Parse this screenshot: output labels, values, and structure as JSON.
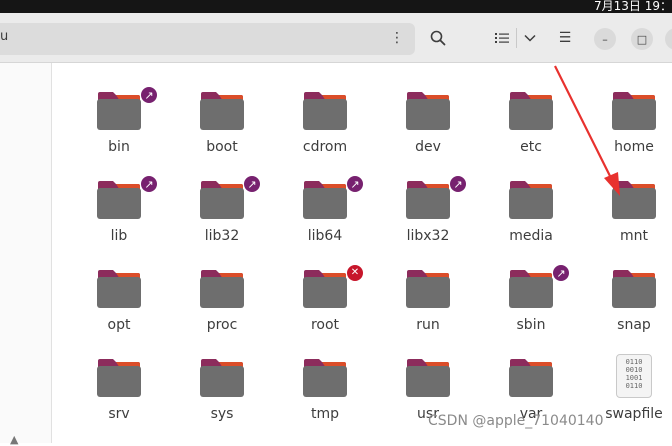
{
  "topbar": {
    "clock": "7月13日 19："
  },
  "pathbar": {
    "crumb": "u",
    "more_glyph": "⋮"
  },
  "headerbar": {
    "search_glyph": "",
    "view_dropdown_glyph": "",
    "menu_glyph": "☰"
  },
  "window_controls": {
    "minimize": "–",
    "maximize": "□",
    "close": "×"
  },
  "files": [
    {
      "name": "bin",
      "type": "folder",
      "emblem": "link"
    },
    {
      "name": "boot",
      "type": "folder",
      "emblem": ""
    },
    {
      "name": "cdrom",
      "type": "folder",
      "emblem": ""
    },
    {
      "name": "dev",
      "type": "folder",
      "emblem": ""
    },
    {
      "name": "etc",
      "type": "folder",
      "emblem": ""
    },
    {
      "name": "home",
      "type": "folder",
      "emblem": ""
    },
    {
      "name": "lib",
      "type": "folder",
      "emblem": "link"
    },
    {
      "name": "lib32",
      "type": "folder",
      "emblem": "link"
    },
    {
      "name": "lib64",
      "type": "folder",
      "emblem": "link"
    },
    {
      "name": "libx32",
      "type": "folder",
      "emblem": "link"
    },
    {
      "name": "media",
      "type": "folder",
      "emblem": ""
    },
    {
      "name": "mnt",
      "type": "folder",
      "emblem": ""
    },
    {
      "name": "opt",
      "type": "folder",
      "emblem": ""
    },
    {
      "name": "proc",
      "type": "folder",
      "emblem": ""
    },
    {
      "name": "root",
      "type": "folder",
      "emblem": "no-access"
    },
    {
      "name": "run",
      "type": "folder",
      "emblem": ""
    },
    {
      "name": "sbin",
      "type": "folder",
      "emblem": "link"
    },
    {
      "name": "snap",
      "type": "folder",
      "emblem": ""
    },
    {
      "name": "srv",
      "type": "folder",
      "emblem": ""
    },
    {
      "name": "sys",
      "type": "folder",
      "emblem": ""
    },
    {
      "name": "tmp",
      "type": "folder",
      "emblem": ""
    },
    {
      "name": "usr",
      "type": "folder",
      "emblem": ""
    },
    {
      "name": "var",
      "type": "folder",
      "emblem": ""
    },
    {
      "name": "swapfile",
      "type": "binary",
      "emblem": "no-access",
      "binary_text": "0110\n0010\n1001\n0110"
    }
  ],
  "emblem_glyphs": {
    "link": "↗",
    "no-access": "✕"
  },
  "colors": {
    "folder_top": "#8c2c5c",
    "folder_tab_accent": "#e95420",
    "folder_body": "#6e6e6e",
    "link_emblem": "#77216f",
    "noaccess_emblem": "#c7162b",
    "annotation_arrow": "#e8312e"
  },
  "watermark": "CSDN @apple_71040140"
}
